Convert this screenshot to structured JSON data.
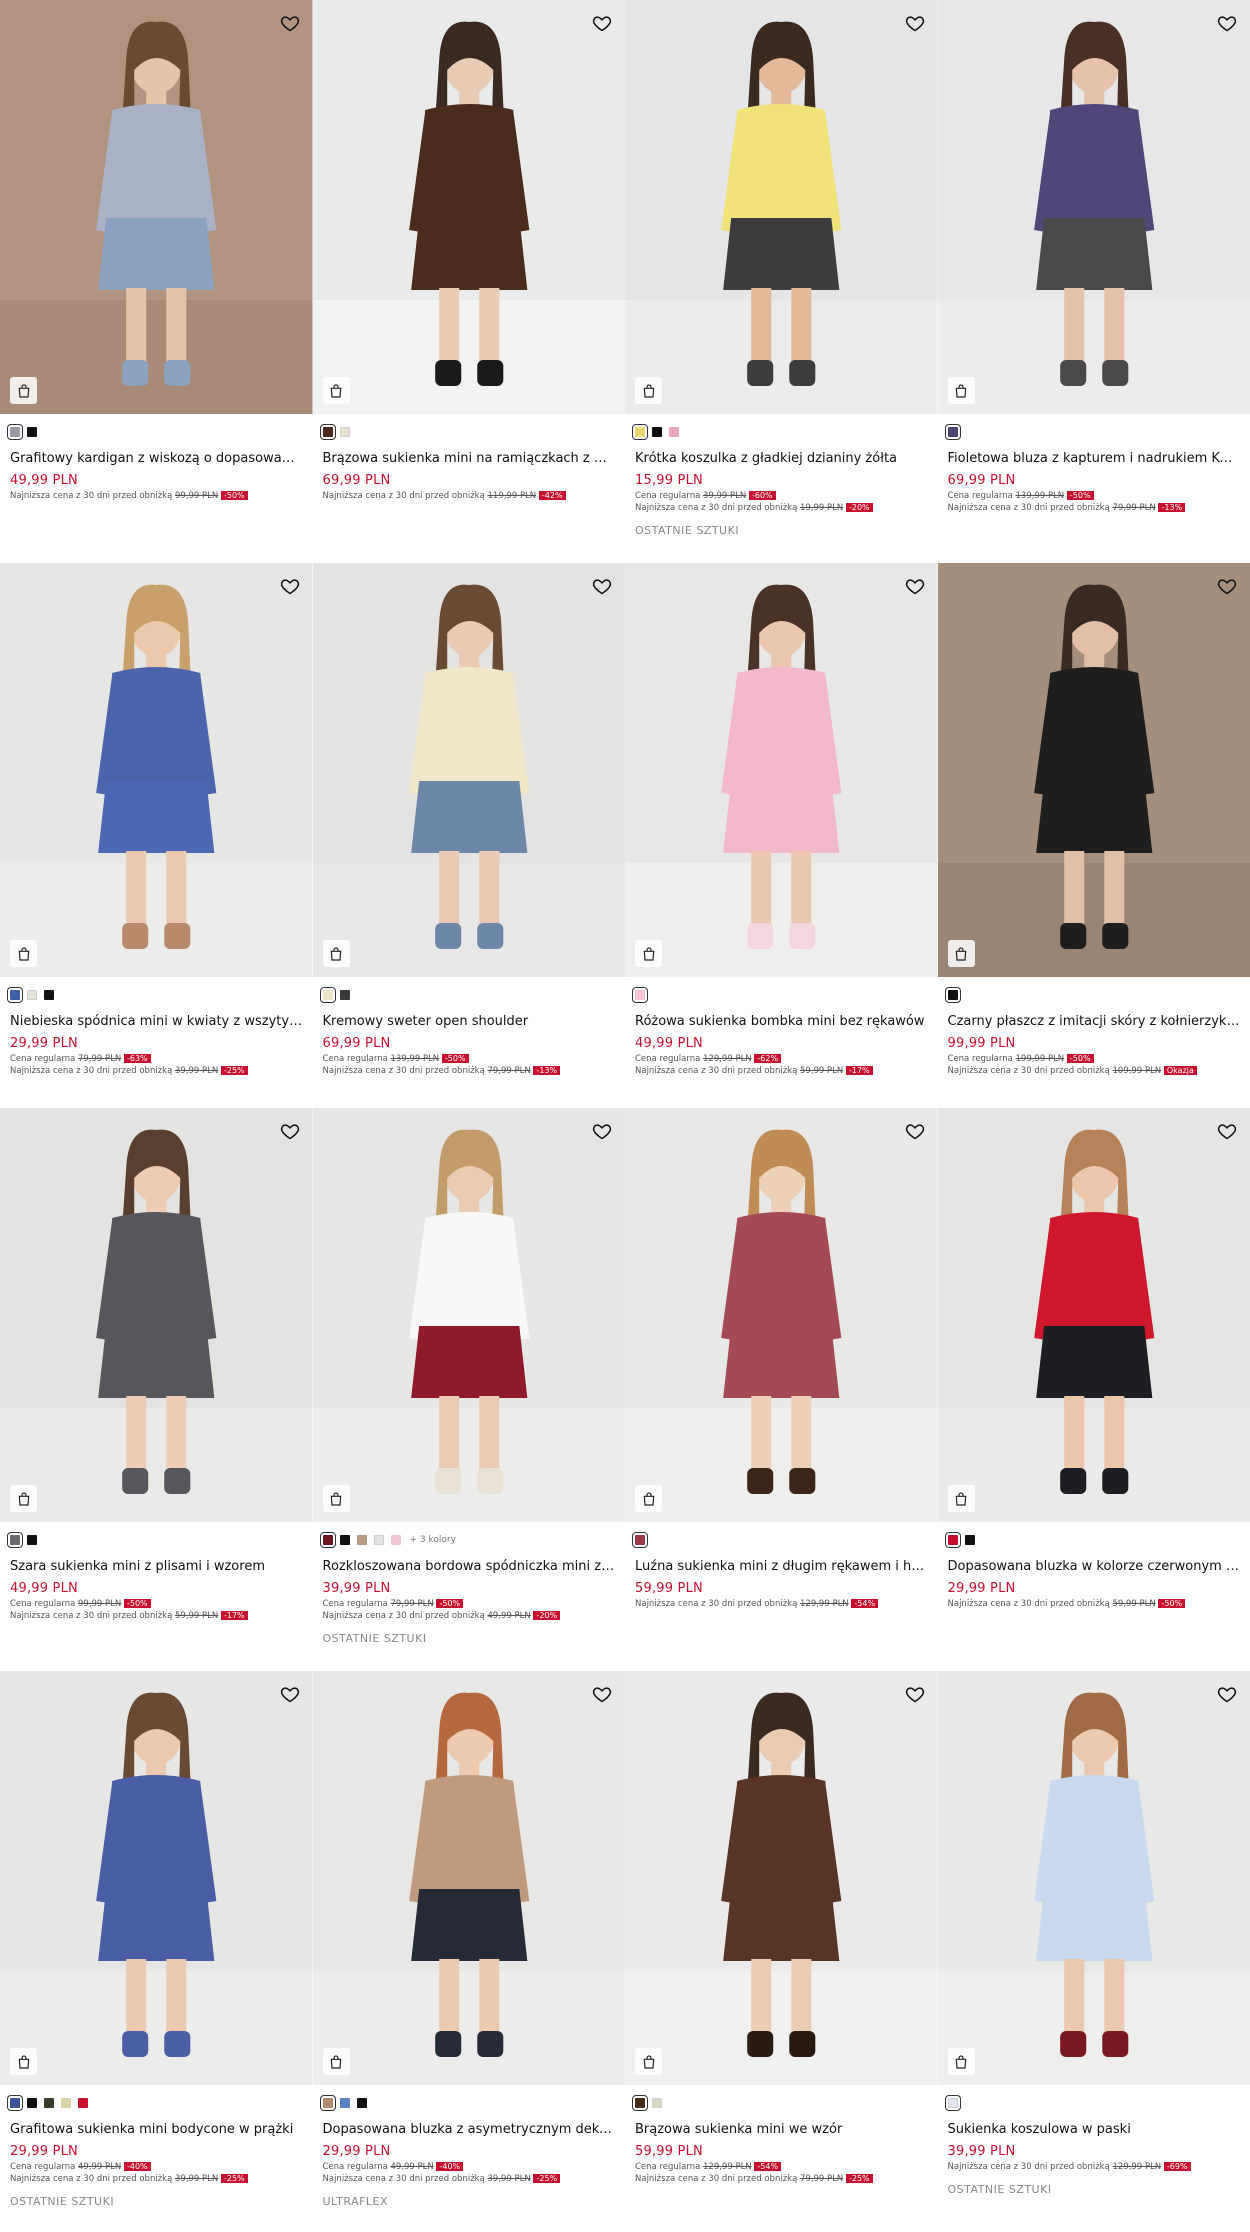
{
  "currency_note": "PLN",
  "products": [
    {
      "name": "Grafitowy kardigan z wiskozą o dopasowanym kroju",
      "price": "49,99 PLN",
      "regular_label": "",
      "regular_price": "",
      "regular_badge": "",
      "lowest_label": "Najniższa cena z 30 dni przed obniżką",
      "lowest_price": "99,99 PLN",
      "lowest_badge": "-50%",
      "tag": "",
      "more_colors": "",
      "swatches": [
        "#9a9aa2",
        "#111111"
      ],
      "photo": {
        "bg": "#b29380",
        "floor": "#a88a77",
        "skin": "#e6c3a9",
        "hair": "#6b4a34",
        "top": "#a9b1c7",
        "bottom": "#8aa1c0",
        "shoes": "#8aa1c0"
      }
    },
    {
      "name": "Brązowa sukienka mini na ramiączkach z wstawką",
      "price": "69,99 PLN",
      "regular_label": "",
      "regular_price": "",
      "regular_badge": "",
      "lowest_label": "Najniższa cena z 30 dni przed obniżką",
      "lowest_price": "119,99 PLN",
      "lowest_badge": "-42%",
      "tag": "",
      "more_colors": "",
      "swatches": [
        "#4a2a1a",
        "#e8e2cf"
      ],
      "photo": {
        "bg": "#e9eaea",
        "floor": "#f2f2f2",
        "skin": "#e8cbb5",
        "hair": "#3a2a22",
        "top": "#4b2c1c",
        "bottom": "#4b2c1c",
        "shoes": "#1a1a1a"
      }
    },
    {
      "name": "Krótka koszulka z gładkiej dzianiny żółta",
      "price": "15,99 PLN",
      "regular_label": "Cena regularna",
      "regular_price": "39,99 PLN",
      "regular_badge": "-60%",
      "lowest_label": "Najniższa cena z 30 dni przed obniżką",
      "lowest_price": "19,99 PLN",
      "lowest_badge": "-20%",
      "tag": "OSTATNIE SZTUKI",
      "more_colors": "",
      "swatches": [
        "#e8d96a",
        "#111111",
        "#e8a7bd"
      ],
      "photo": {
        "bg": "#e4e5e6",
        "floor": "#ebebeb",
        "skin": "#e3b99a",
        "hair": "#3b2a20",
        "top": "#f1e37a",
        "bottom": "#3d3d40",
        "shoes": "#3d3d40"
      }
    },
    {
      "name": "Fioletowa bluza z kapturem i nadrukiem Kuromi",
      "price": "69,99 PLN",
      "regular_label": "Cena regularna",
      "regular_price": "139,99 PLN",
      "regular_badge": "-50%",
      "lowest_label": "Najniższa cena z 30 dni przed obniżką",
      "lowest_price": "79,99 PLN",
      "lowest_badge": "-13%",
      "tag": "",
      "more_colors": "",
      "swatches": [
        "#4e4570"
      ],
      "photo": {
        "bg": "#e7e7e7",
        "floor": "#ececec",
        "skin": "#e6c2ab",
        "hair": "#4a3024",
        "top": "#51467a",
        "bottom": "#4a4848",
        "shoes": "#4a4848"
      }
    },
    {
      "name": "Niebieska spódnica mini w kwiaty z wszytymi szortami",
      "price": "29,99 PLN",
      "regular_label": "Cena regularna",
      "regular_price": "79,99 PLN",
      "regular_badge": "-63%",
      "lowest_label": "Najniższa cena z 30 dni przed obniżką",
      "lowest_price": "39,99 PLN",
      "lowest_badge": "-25%",
      "tag": "",
      "more_colors": "",
      "swatches": [
        "#3e5fa8",
        "#e7e4d8",
        "#111111"
      ],
      "photo": {
        "bg": "#e6e6e5",
        "floor": "#ececeb",
        "skin": "#ecc8ad",
        "hair": "#c9a06c",
        "top": "#4b65ad",
        "bottom": "#4a68b3",
        "shoes": "#b98a6a"
      }
    },
    {
      "name": "Kremowy sweter open shoulder",
      "price": "69,99 PLN",
      "regular_label": "Cena regularna",
      "regular_price": "139,99 PLN",
      "regular_badge": "-50%",
      "lowest_label": "Najniższa cena z 30 dni przed obniżką",
      "lowest_price": "79,99 PLN",
      "lowest_badge": "-13%",
      "tag": "",
      "more_colors": "",
      "swatches": [
        "#ede4c8",
        "#3a3a3a"
      ],
      "photo": {
        "bg": "#e3e3e2",
        "floor": "#e8e8e7",
        "skin": "#ecc9b2",
        "hair": "#6b4a34",
        "top": "#f0e6c8",
        "bottom": "#6d87a8",
        "shoes": "#6d87a8"
      }
    },
    {
      "name": "Różowa sukienka bombka mini bez rękawów",
      "price": "49,99 PLN",
      "regular_label": "Cena regularna",
      "regular_price": "129,99 PLN",
      "regular_badge": "-62%",
      "lowest_label": "Najniższa cena z 30 dni przed obniżką",
      "lowest_price": "59,99 PLN",
      "lowest_badge": "-17%",
      "tag": "",
      "more_colors": "",
      "swatches": [
        "#f2c6d3"
      ],
      "photo": {
        "bg": "#e7e7e6",
        "floor": "#eeeeed",
        "skin": "#ebc7ae",
        "hair": "#4a3226",
        "top": "#f3b8cc",
        "bottom": "#f3b8cc",
        "shoes": "#f5d5de"
      }
    },
    {
      "name": "Czarny płaszcz z imitacji skóry z kołnierzykiem",
      "price": "99,99 PLN",
      "regular_label": "Cena regularna",
      "regular_price": "199,99 PLN",
      "regular_badge": "-50%",
      "lowest_label": "Najniższa cena z 30 dni przed obniżką",
      "lowest_price": "109,99 PLN",
      "lowest_badge": "Okazja",
      "tag": "",
      "more_colors": "",
      "swatches": [
        "#111111"
      ],
      "photo": {
        "bg": "#a58e7b",
        "floor": "#9a8473",
        "skin": "#e2bfa6",
        "hair": "#3a2a22",
        "top": "#1e1e1e",
        "bottom": "#1e1e1e",
        "shoes": "#1e1e1e"
      }
    },
    {
      "name": "Szara sukienka mini z plisami i wzorem",
      "price": "49,99 PLN",
      "regular_label": "Cena regularna",
      "regular_price": "99,99 PLN",
      "regular_badge": "-50%",
      "lowest_label": "Najniższa cena z 30 dni przed obniżką",
      "lowest_price": "59,99 PLN",
      "lowest_badge": "-17%",
      "tag": "",
      "more_colors": "",
      "swatches": [
        "#6b6b70",
        "#111111"
      ],
      "photo": {
        "bg": "#e3e3e1",
        "floor": "#e9e9e7",
        "skin": "#eecbb2",
        "hair": "#5b3f2e",
        "top": "#57565b",
        "bottom": "#57565b",
        "shoes": "#57565b"
      }
    },
    {
      "name": "Rozkloszowana bordowa spódniczka mini ze szortami",
      "price": "39,99 PLN",
      "regular_label": "Cena regularna",
      "regular_price": "79,99 PLN",
      "regular_badge": "-50%",
      "lowest_label": "Najniższa cena z 30 dni przed obniżką",
      "lowest_price": "49,99 PLN",
      "lowest_badge": "-20%",
      "tag": "OSTATNIE SZTUKI",
      "more_colors": "+ 3 kolory",
      "swatches": [
        "#6a1620",
        "#111111",
        "#b79a82",
        "#e4e4e2",
        "#f2c6d3"
      ],
      "photo": {
        "bg": "#e6e6e5",
        "floor": "#ececeb",
        "skin": "#eccbb3",
        "hair": "#c49b6b",
        "top": "#f8f8f8",
        "bottom": "#8e1a2a",
        "shoes": "#e8e2d6"
      }
    },
    {
      "name": "Luźna sukienka mini z długim rękawem i haftem",
      "price": "59,99 PLN",
      "regular_label": "",
      "regular_price": "",
      "regular_badge": "",
      "lowest_label": "Najniższa cena z 30 dni przed obniżką",
      "lowest_price": "129,99 PLN",
      "lowest_badge": "-54%",
      "tag": "",
      "more_colors": "",
      "swatches": [
        "#9c3a4a"
      ],
      "photo": {
        "bg": "#e8e8e7",
        "floor": "#eeeeed",
        "skin": "#edd0b8",
        "hair": "#c08c55",
        "top": "#a34a55",
        "bottom": "#a34a55",
        "shoes": "#3d2418"
      }
    },
    {
      "name": "Dopasowana bluzka w kolorze czerwonym z dekoltem",
      "price": "29,99 PLN",
      "regular_label": "",
      "regular_price": "",
      "regular_badge": "",
      "lowest_label": "Najniższa cena z 30 dni przed obniżką",
      "lowest_price": "59,99 PLN",
      "lowest_badge": "-50%",
      "tag": "",
      "more_colors": "",
      "swatches": [
        "#c8102e",
        "#111111"
      ],
      "photo": {
        "bg": "#e5e5e4",
        "floor": "#eaeae9",
        "skin": "#ecc6ab",
        "hair": "#b5825a",
        "top": "#d0182d",
        "bottom": "#1e1e22",
        "shoes": "#1e1e22"
      }
    },
    {
      "name": "Grafitowa sukienka mini bodycone w prążki",
      "price": "29,99 PLN",
      "regular_label": "Cena regularna",
      "regular_price": "49,99 PLN",
      "regular_badge": "-40%",
      "lowest_label": "Najniższa cena z 30 dni przed obniżką",
      "lowest_price": "39,99 PLN",
      "lowest_badge": "-25%",
      "tag": "OSTATNIE SZTUKI",
      "more_colors": "",
      "swatches": [
        "#3e5298",
        "#111111",
        "#3a3a2a",
        "#d8d2a6",
        "#c8102e"
      ],
      "photo": {
        "bg": "#e6e6e5",
        "floor": "#ececeb",
        "skin": "#ecc8ae",
        "hair": "#6b4a34",
        "top": "#4a5ea6",
        "bottom": "#4a5ea6",
        "shoes": "#4a5ea6"
      }
    },
    {
      "name": "Dopasowana bluzka z asymetrycznym dekoltem",
      "price": "29,99 PLN",
      "regular_label": "Cena regularna",
      "regular_price": "49,99 PLN",
      "regular_badge": "-40%",
      "lowest_label": "Najniższa cena z 30 dni przed obniżką",
      "lowest_price": "39,99 PLN",
      "lowest_badge": "-25%",
      "tag": "ULTRAFLEX",
      "more_colors": "",
      "swatches": [
        "#b08a6b",
        "#5a85c4",
        "#111111"
      ],
      "photo": {
        "bg": "#e7e7e6",
        "floor": "#ececeb",
        "skin": "#edc9ae",
        "hair": "#b5683e",
        "top": "#c19a7d",
        "bottom": "#262a36",
        "shoes": "#262a36"
      }
    },
    {
      "name": "Brązowa sukienka mini we wzór",
      "price": "59,99 PLN",
      "regular_label": "Cena regularna",
      "regular_price": "129,99 PLN",
      "regular_badge": "-54%",
      "lowest_label": "Najniższa cena z 30 dni przed obniżką",
      "lowest_price": "79,99 PLN",
      "lowest_badge": "-25%",
      "tag": "",
      "more_colors": "",
      "swatches": [
        "#4a2a1a",
        "#d8d7c6"
      ],
      "photo": {
        "bg": "#eaeaea",
        "floor": "#f0f0f0",
        "skin": "#eccbb3",
        "hair": "#3b2a20",
        "top": "#5a3526",
        "bottom": "#5a3526",
        "shoes": "#2a1a12"
      }
    },
    {
      "name": "Sukienka koszulowa w paski",
      "price": "39,99 PLN",
      "regular_label": "",
      "regular_price": "",
      "regular_badge": "",
      "lowest_label": "Najniższa cena z 30 dni przed obniżką",
      "lowest_price": "129,99 PLN",
      "lowest_badge": "-69%",
      "tag": "OSTATNIE SZTUKI",
      "more_colors": "",
      "swatches": [
        "#dfe6f2"
      ],
      "photo": {
        "bg": "#e8e8e7",
        "floor": "#eeeeed",
        "skin": "#ecc9ae",
        "hair": "#a06a44",
        "top": "#c9d9ef",
        "bottom": "#c9d9ef",
        "shoes": "#7a1a20"
      }
    }
  ]
}
